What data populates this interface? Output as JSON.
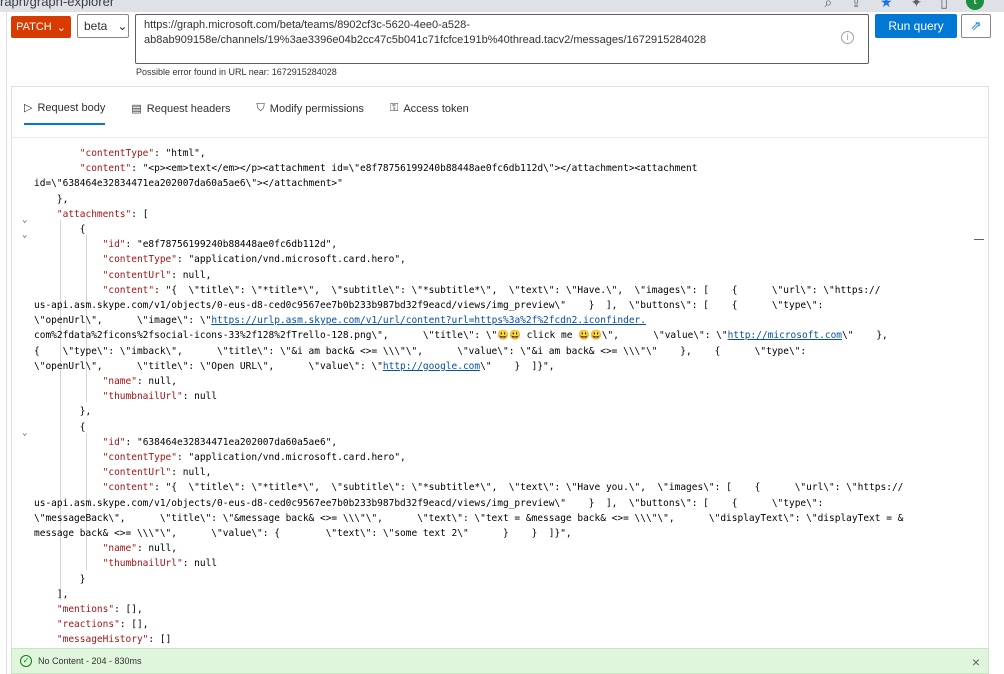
{
  "browser": {
    "url_fragment": "raph/graph-explorer",
    "avatar_letter": "t"
  },
  "request": {
    "method": "PATCH",
    "version": "beta",
    "url_line1": "https://graph.microsoft.com/beta/teams/8902cf3c-5620-4ee0-a528-",
    "url_line2": "ab8ab909158e/channels/19%3ae3396e04b2cc47c5b041c71fcfce191b%40thread.tacv2/messages/1672915284028",
    "url_error": "Possible error found in URL near: 1672915284028",
    "run_label": "Run query"
  },
  "tabs": [
    {
      "label": "Request body"
    },
    {
      "label": "Request headers"
    },
    {
      "label": "Modify permissions"
    },
    {
      "label": "Access token"
    }
  ],
  "editor": {
    "lines": [
      "        \"contentType\": \"html\",",
      "        \"content\": \"<p><em>text</em></p><attachment id=\\\"e8f78756199240b88448ae0fc6db112d\\\"></attachment><attachment",
      "id=\\\"638464e32834471ea202007da60a5ae6\\\"></attachment>\"",
      "    },",
      "    \"attachments\": [",
      "        {",
      "            \"id\": \"e8f78756199240b88448ae0fc6db112d\",",
      "            \"contentType\": \"application/vnd.microsoft.card.hero\",",
      "            \"contentUrl\": null,",
      "            \"content\": \"{  \\\"title\\\": \\\"*title*\\\",  \\\"subtitle\\\": \\\"*subtitle*\\\",  \\\"text\\\": \\\"Have.\\\",  \\\"images\\\": [    {      \\\"url\\\": \\\"https://",
      "us-api.asm.skype.com/v1/objects/0-eus-d8-ced0c9567ee7b0b233b987bd32f9eacd/views/img_preview\\\"    }  ],  \\\"buttons\\\": [    {      \\\"type\\\":",
      "\\\"openUrl\\\",      \\\"image\\\": \\\"https://urlp.asm.skype.com/v1/url/content?url=https%3a%2f%2fcdn2.iconfinder.",
      "com%2fdata%2ficons%2fsocial-icons-33%2f128%2fTrello-128.png\\\",      \\\"title\\\": \\\"😃😃 click me 😃😃\\\",      \\\"value\\\": \\\"http://microsoft.com\\\"    },",
      "{    \\\"type\\\": \\\"imback\\\",      \\\"title\\\": \\\"&i am back& <>= \\\\\\\"\\\",      \\\"value\\\": \\\"&i am back& <>= \\\\\\\"\\\"    },    {      \\\"type\\\":",
      "\\\"openUrl\\\",      \\\"title\\\": \\\"Open URL\\\",      \\\"value\\\": \\\"http://google.com\\\"    }  ]}\",",
      "            \"name\": null,",
      "            \"thumbnailUrl\": null",
      "        },",
      "        {",
      "            \"id\": \"638464e32834471ea202007da60a5ae6\",",
      "            \"contentType\": \"application/vnd.microsoft.card.hero\",",
      "            \"contentUrl\": null,",
      "            \"content\": \"{  \\\"title\\\": \\\"*title*\\\",  \\\"subtitle\\\": \\\"*subtitle*\\\",  \\\"text\\\": \\\"Have you.\\\",  \\\"images\\\": [    {      \\\"url\\\": \\\"https://",
      "us-api.asm.skype.com/v1/objects/0-eus-d8-ced0c9567ee7b0b233b987bd32f9eacd/views/img_preview\\\"    }  ],  \\\"buttons\\\": [    {      \\\"type\\\":",
      "\\\"messageBack\\\",      \\\"title\\\": \\\"&message back& <>= \\\\\\\"\\\",      \\\"text\\\": \\\"text = &message back& <>= \\\\\\\"\\\",      \\\"displayText\\\": \\\"displayText = &",
      "message back& <>= \\\\\\\"\\\",      \\\"value\\\": {        \\\"text\\\": \\\"some text 2\\\"      }    }  ]}\",",
      "            \"name\": null,",
      "            \"thumbnailUrl\": null",
      "        }",
      "    ],",
      "    \"mentions\": [],",
      "    \"reactions\": [],",
      "    \"messageHistory\": []"
    ]
  },
  "status": {
    "text": "No Content - 204 - 830ms"
  },
  "colors": {
    "method": "#d83b01",
    "accent": "#0078d4",
    "success_bg": "#dff6dd"
  }
}
